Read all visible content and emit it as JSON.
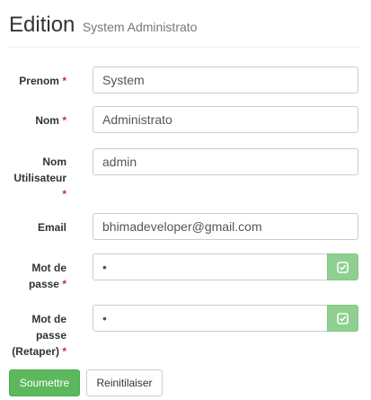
{
  "header": {
    "title": "Edition",
    "subtitle": "System Administrato"
  },
  "form": {
    "required_mark": "*",
    "prenom": {
      "label": "Prenom",
      "value": "System"
    },
    "nom": {
      "label": "Nom",
      "value": "Administrato"
    },
    "username": {
      "label_line1": "Nom",
      "label_line2": "Utilisateur",
      "value": "admin"
    },
    "email": {
      "label": "Email",
      "value": "bhimadeveloper@gmail.com"
    },
    "password": {
      "label_line1": "Mot de",
      "label_line2": "passe",
      "value": "•",
      "addon_icon": "check-square-icon"
    },
    "password_confirm": {
      "label_line1": "Mot de",
      "label_line2": "passe",
      "label_line3": "(Retaper)",
      "value": "•",
      "addon_icon": "check-square-icon"
    }
  },
  "buttons": {
    "submit": "Soumettre",
    "reset": "Reinitilaiser"
  },
  "colors": {
    "success": "#5cb85c",
    "addon": "#8fcf8f",
    "required": "#c9302c"
  }
}
